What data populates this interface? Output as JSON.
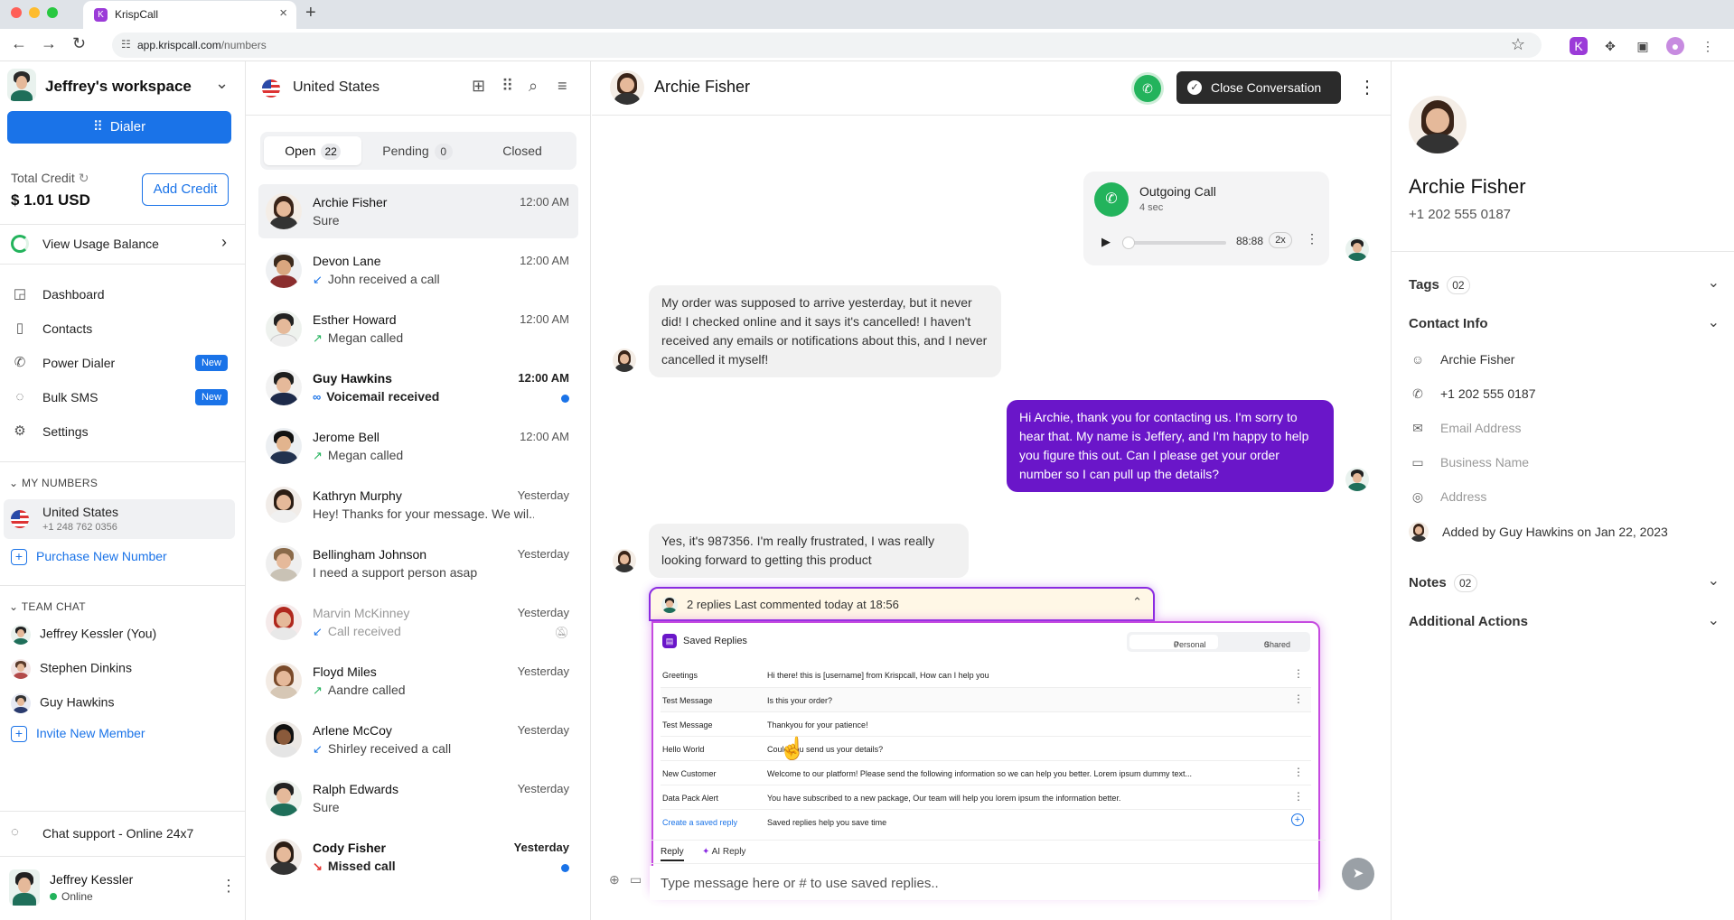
{
  "browser": {
    "tab_title": "KrispCall",
    "url_host": "app.krispcall.com",
    "url_path": "/numbers"
  },
  "sidebar": {
    "workspace": "Jeffrey's workspace",
    "dialer_label": "Dialer",
    "credit_label": "Total Credit",
    "credit_value": "$ 1.01 USD",
    "add_credit_label": "Add Credit",
    "usage_label": "View Usage Balance",
    "nav": [
      {
        "label": "Dashboard",
        "icon": "dashboard-icon"
      },
      {
        "label": "Contacts",
        "icon": "contacts-book-icon"
      },
      {
        "label": "Power Dialer",
        "icon": "power-dialer-icon",
        "badge": "New"
      },
      {
        "label": "Bulk SMS",
        "icon": "bulk-sms-icon",
        "badge": "New"
      },
      {
        "label": "Settings",
        "icon": "gear-icon"
      }
    ],
    "my_numbers_heading": "MY NUMBERS",
    "my_number": {
      "name": "United States",
      "number": "+1 248 762 0356"
    },
    "purchase_label": "Purchase New Number",
    "team_chat_heading": "TEAM CHAT",
    "team": [
      "Jeffrey Kessler (You)",
      "Stephen Dinkins",
      "Guy Hawkins"
    ],
    "invite_label": "Invite New Member",
    "chat_support": "Chat support - Online 24x7",
    "user": {
      "name": "Jeffrey Kessler",
      "status": "Online"
    }
  },
  "conversations": {
    "title": "United States",
    "tabs": [
      {
        "label": "Open",
        "count": "22"
      },
      {
        "label": "Pending",
        "count": "0"
      },
      {
        "label": "Closed",
        "count": ""
      }
    ],
    "items": [
      {
        "name": "Archie Fisher",
        "preview": "Sure",
        "time": "12:00 AM",
        "arrow": ""
      },
      {
        "name": "Devon Lane",
        "preview": "John received a call",
        "time": "12:00 AM",
        "arrow": "↙"
      },
      {
        "name": "Esther Howard",
        "preview": "Megan called",
        "time": "12:00 AM",
        "arrow": "↗"
      },
      {
        "name": "Guy Hawkins",
        "preview": "Voicemail received",
        "time": "12:00 AM",
        "arrow": "∞"
      },
      {
        "name": "Jerome Bell",
        "preview": "Megan called",
        "time": "12:00 AM",
        "arrow": "↗"
      },
      {
        "name": "Kathryn Murphy",
        "preview": "Hey! Thanks for your message. We wil...",
        "time": "Yesterday",
        "arrow": ""
      },
      {
        "name": "Bellingham Johnson",
        "preview": "I need a support person asap",
        "time": "Yesterday",
        "arrow": ""
      },
      {
        "name": "Marvin McKinney",
        "preview": "Call received",
        "time": "Yesterday",
        "arrow": "↙"
      },
      {
        "name": "Floyd Miles",
        "preview": "Aandre called",
        "time": "Yesterday",
        "arrow": "↗"
      },
      {
        "name": "Arlene McCoy",
        "preview": "Shirley received a call",
        "time": "Yesterday",
        "arrow": "↙"
      },
      {
        "name": "Ralph Edwards",
        "preview": "Sure",
        "time": "Yesterday",
        "arrow": ""
      },
      {
        "name": "Cody Fisher",
        "preview": "Missed call",
        "time": "Yesterday",
        "arrow": "↘"
      }
    ]
  },
  "chat": {
    "contact_name": "Archie Fisher",
    "close_label": "Close Conversation",
    "call_card": {
      "title": "Outgoing Call",
      "duration": "4 sec",
      "time": "88:88",
      "speed": "2x"
    },
    "messages": [
      "My order was supposed to arrive yesterday, but it never did! I checked online and it says it's cancelled! I haven't received any emails or notifications about this, and I never cancelled it myself!",
      "Hi Archie, thank you for contacting us. I'm sorry to hear that. My name is Jeffery, and I'm happy to help you figure this out. Can I please get your order number so I can pull up the details?",
      "Yes, it's 987356. I'm really frustrated, I was really looking forward to getting this product"
    ],
    "thread": "2 replies  Last commented today at 18:56",
    "saved_replies": {
      "title": "Saved Replies",
      "tab_personal": "Personal",
      "tab_personal_count": "0",
      "tab_shared": "Shared",
      "tab_shared_count": "0",
      "rows": [
        {
          "name": "Greetings",
          "text": "Hi there! this is [username] from Krispcall, How can I help you"
        },
        {
          "name": "Test Message",
          "text": "Is this your order?"
        },
        {
          "name": "Test Message",
          "text": "Thankyou for your patience!"
        },
        {
          "name": "Hello World",
          "text": "Could you send us your details?"
        },
        {
          "name": "New Customer",
          "text": "Welcome to our platform! Please send the following information so we can help you better. Lorem ipsum dummy text..."
        },
        {
          "name": "Data Pack Alert",
          "text": "You have subscribed to a new package, Our team will help you lorem ipsum the information better."
        }
      ],
      "create_label": "Create a saved reply",
      "create_hint": "Saved replies help you save time"
    },
    "reply_tab": "Reply",
    "ai_reply_tab": "AI Reply",
    "input_placeholder": "Type message here or # to use saved replies.."
  },
  "contact": {
    "name": "Archie Fisher",
    "phone": "+1 202 555 0187",
    "tags_label": "Tags",
    "tags_count": "02",
    "info_label": "Contact Info",
    "info": {
      "name": "Archie Fisher",
      "phone": "+1 202 555 0187",
      "email": "Email Address",
      "business": "Business Name",
      "address": "Address"
    },
    "added_by": "Added by Guy Hawkins on Jan 22, 2023",
    "notes_label": "Notes",
    "notes_count": "02",
    "actions_label": "Additional Actions"
  },
  "colors": {
    "brand": "#1a73e8",
    "accent_purple": "#6a16c9",
    "call_green": "#23b35c"
  }
}
